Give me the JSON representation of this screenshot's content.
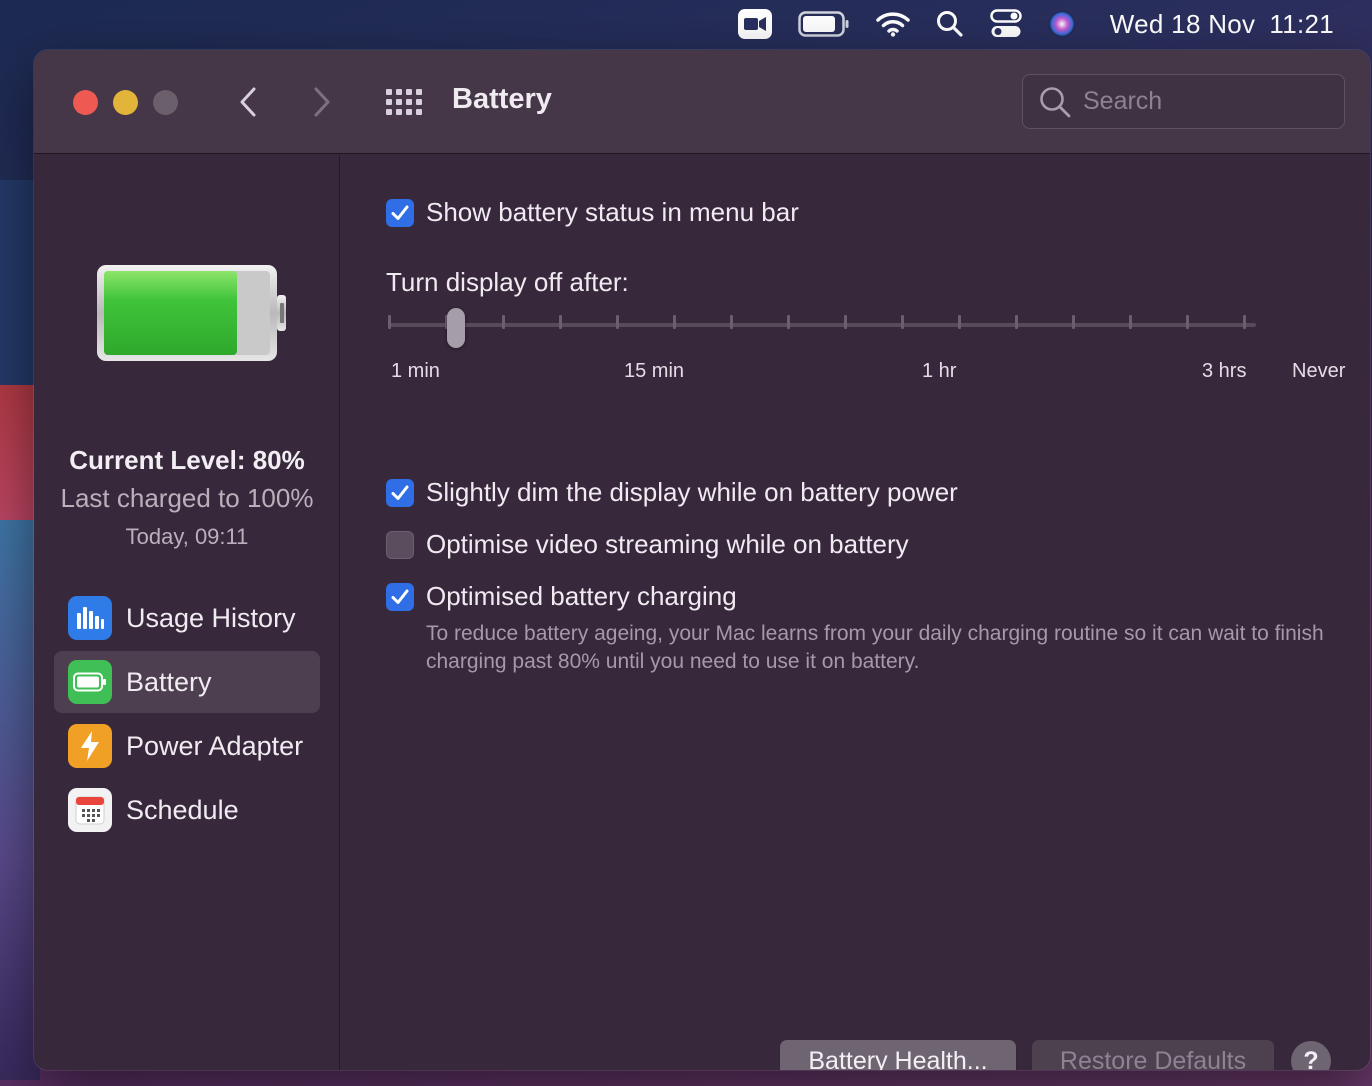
{
  "menubar": {
    "icons": [
      "video-camera-icon",
      "battery-icon",
      "wifi-icon",
      "search-icon",
      "control-center-icon",
      "siri-icon"
    ],
    "date": "Wed 18 Nov",
    "time": "11:21"
  },
  "window": {
    "title": "Battery",
    "search_placeholder": "Search"
  },
  "sidebar": {
    "current_level": "Current Level: 80%",
    "last_charged": "Last charged to 100%",
    "charged_time": "Today, 09:11",
    "battery_fill_fraction": 0.8,
    "items": [
      {
        "label": "Usage History",
        "icon": "bar-chart-icon",
        "color": "#2f7be8",
        "selected": false
      },
      {
        "label": "Battery",
        "icon": "battery-icon",
        "color": "#3fbf55",
        "selected": true
      },
      {
        "label": "Power Adapter",
        "icon": "lightning-icon",
        "color": "#f0a024",
        "selected": false
      },
      {
        "label": "Schedule",
        "icon": "calendar-icon",
        "color": "#f2f2f2",
        "selected": false
      }
    ]
  },
  "settings": {
    "show_status": {
      "label": "Show battery status in menu bar",
      "checked": true
    },
    "display_off": {
      "title": "Turn display off after:",
      "tick_labels": [
        "1 min",
        "15 min",
        "1 hr",
        "3 hrs",
        "Never"
      ],
      "value": "2 min"
    },
    "dim_display": {
      "label": "Slightly dim the display while on battery power",
      "checked": true
    },
    "optimise_video": {
      "label": "Optimise video streaming while on battery",
      "checked": false
    },
    "optimised_charging": {
      "label": "Optimised battery charging",
      "checked": true,
      "description": "To reduce battery ageing, your Mac learns from your daily charging routine so it can wait to finish charging past 80% until you need to use it on battery."
    }
  },
  "buttons": {
    "battery_health": "Battery Health...",
    "restore_defaults": "Restore Defaults",
    "help": "?"
  },
  "colors": {
    "accent": "#2f6ee5",
    "window_bg": "#38283c",
    "battery_green": "#3fc43a"
  }
}
